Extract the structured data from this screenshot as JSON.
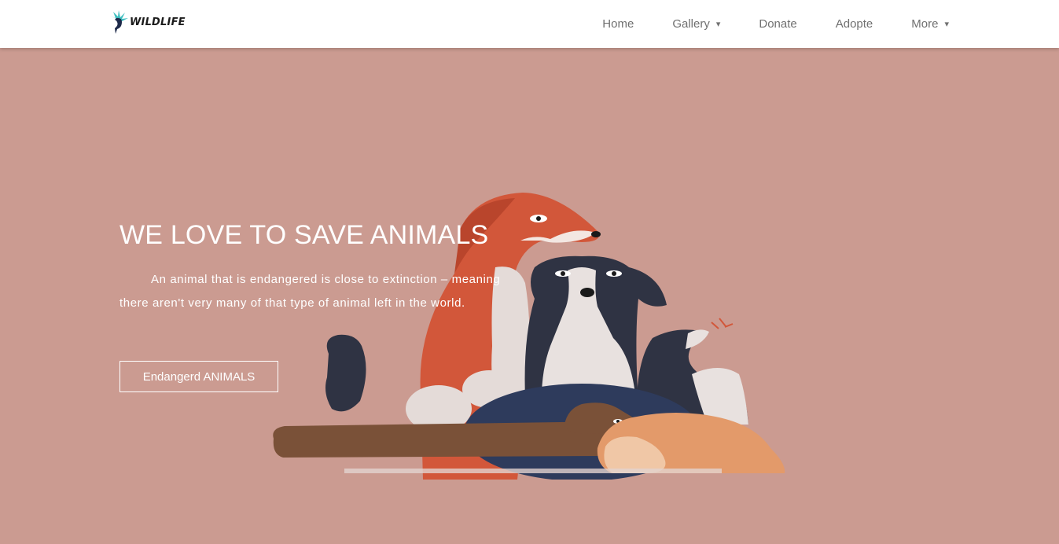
{
  "navbar": {
    "logo": {
      "text": "WILDLIFE",
      "icon": "hummingbird-icon"
    },
    "links": [
      {
        "label": "Home"
      },
      {
        "label": "Gallery",
        "caret": "▾"
      },
      {
        "label": "Donate"
      },
      {
        "label": "Adopte"
      },
      {
        "label": "More",
        "caret": "▾"
      }
    ]
  },
  "hero": {
    "title": "WE LOVE TO SAVE ANIMALS",
    "text": "An animal that is endangered is close to extinction – meaning there aren't very many of that type of animal left in the world.",
    "button_label": "Endangerd ANIMALS"
  },
  "colors": {
    "background": "#cb9b91",
    "navbar": "#ffffff",
    "nav_text": "#707070",
    "hero_text": "#ffffff",
    "dog_orange": "#d2573a",
    "dog_navy": "#2e3b5c",
    "dog_cream": "#e2d8d4"
  }
}
